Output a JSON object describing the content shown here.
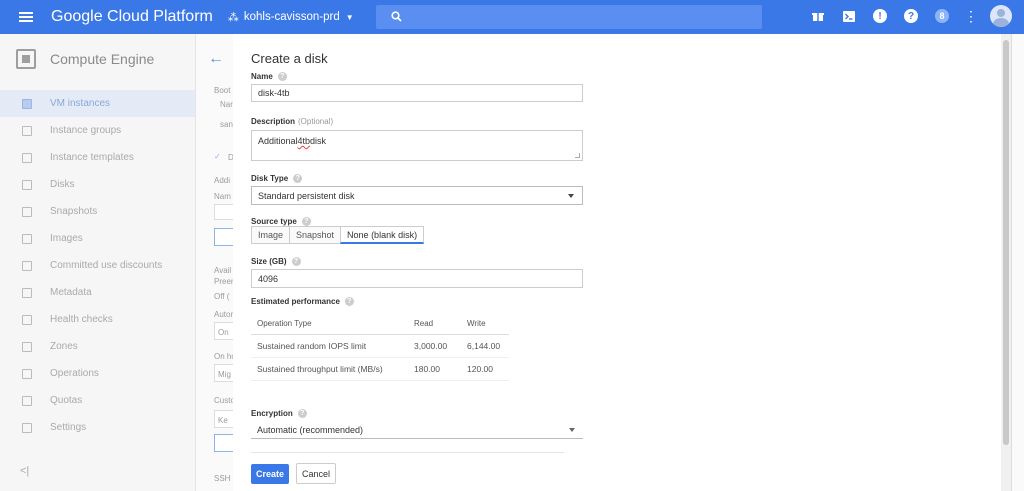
{
  "topbar": {
    "brand": "Google Cloud Platform",
    "project": "kohls-cavisson-prd",
    "user_badge": "8"
  },
  "sidebar": {
    "title": "Compute Engine",
    "items": [
      {
        "label": "VM instances",
        "icon": "vm-icon"
      },
      {
        "label": "Instance groups",
        "icon": "groups-icon"
      },
      {
        "label": "Instance templates",
        "icon": "template-icon"
      },
      {
        "label": "Disks",
        "icon": "disk-icon"
      },
      {
        "label": "Snapshots",
        "icon": "snapshot-icon"
      },
      {
        "label": "Images",
        "icon": "image-icon"
      },
      {
        "label": "Committed use discounts",
        "icon": "percent-icon"
      },
      {
        "label": "Metadata",
        "icon": "metadata-icon"
      },
      {
        "label": "Health checks",
        "icon": "health-icon"
      },
      {
        "label": "Zones",
        "icon": "zones-icon"
      },
      {
        "label": "Operations",
        "icon": "clock-icon"
      },
      {
        "label": "Quotas",
        "icon": "quota-icon"
      },
      {
        "label": "Settings",
        "icon": "gear-icon"
      }
    ],
    "collapse": "<|"
  },
  "background": {
    "boot": "Boot",
    "name_short": "Nar",
    "san": "san",
    "check_d": "D",
    "addi": "Addi",
    "nam": "Nam",
    "avail": "Avail",
    "preem": "Preer",
    "off": "Off (",
    "auto": "Autor",
    "on": "On",
    "on_host": "On ho",
    "mig": "Mig",
    "cust": "Custo",
    "key": "Ke",
    "ssh": "SSH"
  },
  "form": {
    "title": "Create a disk",
    "name_label": "Name",
    "name_value": "disk-4tb",
    "desc_label": "Description",
    "desc_optional": "(Optional)",
    "desc_value_pre": "Additional ",
    "desc_value_err": "4tb",
    "desc_value_post": " disk",
    "disk_type_label": "Disk Type",
    "disk_type_value": "Standard persistent disk",
    "source_type_label": "Source type",
    "source_options": [
      "Image",
      "Snapshot",
      "None (blank disk)"
    ],
    "size_label": "Size (GB)",
    "size_value": "4096",
    "perf_label": "Estimated performance",
    "perf_headers": [
      "Operation Type",
      "Read",
      "Write"
    ],
    "perf_rows": [
      [
        "Sustained random IOPS limit",
        "3,000.00",
        "6,144.00"
      ],
      [
        "Sustained throughput limit (MB/s)",
        "180.00",
        "120.00"
      ]
    ],
    "encryption_label": "Encryption",
    "encryption_value": "Automatic (recommended)",
    "create_label": "Create",
    "cancel_label": "Cancel"
  }
}
